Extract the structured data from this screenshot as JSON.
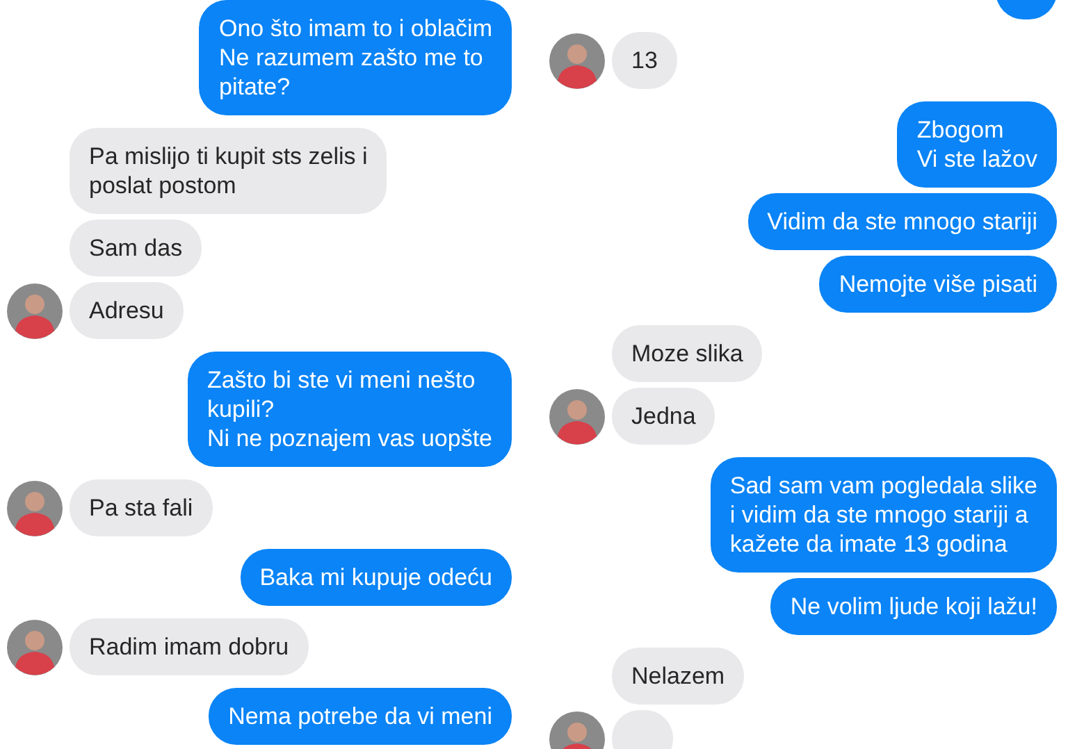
{
  "panels": [
    {
      "messages": [
        {
          "kind": "outgoing",
          "text": "Ono što imam to i oblačim\nNe razumem zašto me to\npitate?"
        },
        {
          "kind": "incoming",
          "avatar": false,
          "text": "Pa mislijo ti kupit sts zelis i\nposlat postom"
        },
        {
          "kind": "incoming",
          "avatar": false,
          "text": "Sam das"
        },
        {
          "kind": "incoming",
          "avatar": true,
          "text": "Adresu"
        },
        {
          "kind": "outgoing",
          "text": "Zašto bi ste vi meni nešto\nkupili?\nNi ne poznajem vas uopšte"
        },
        {
          "kind": "incoming",
          "avatar": true,
          "text": "Pa sta fali"
        },
        {
          "kind": "outgoing",
          "text": "Baka mi kupuje odeću"
        },
        {
          "kind": "incoming",
          "avatar": true,
          "text": "Radim imam dobru"
        },
        {
          "kind": "outgoing",
          "text": "Nema potrebe da vi meni"
        }
      ]
    },
    {
      "messages": [
        {
          "kind": "outgoing"
        },
        {
          "kind": "incoming",
          "avatar": true,
          "text": "13"
        },
        {
          "kind": "outgoing",
          "text": "Zbogom\nVi ste lažov"
        },
        {
          "kind": "outgoing",
          "text": "Vidim da ste mnogo stariji"
        },
        {
          "kind": "outgoing",
          "text": "Nemojte više pisati"
        },
        {
          "kind": "incoming",
          "avatar": false,
          "text": "Moze slika"
        },
        {
          "kind": "incoming",
          "avatar": true,
          "text": "Jedna"
        },
        {
          "kind": "outgoing",
          "text": "Sad sam vam pogledala slike\ni vidim da ste mnogo stariji a\nkažete da imate 13 godina"
        },
        {
          "kind": "outgoing",
          "text": "Ne volim ljude koji lažu!"
        },
        {
          "kind": "incoming",
          "avatar": false,
          "text": "Nelazem"
        },
        {
          "kind": "incoming",
          "avatar": true
        }
      ]
    }
  ]
}
